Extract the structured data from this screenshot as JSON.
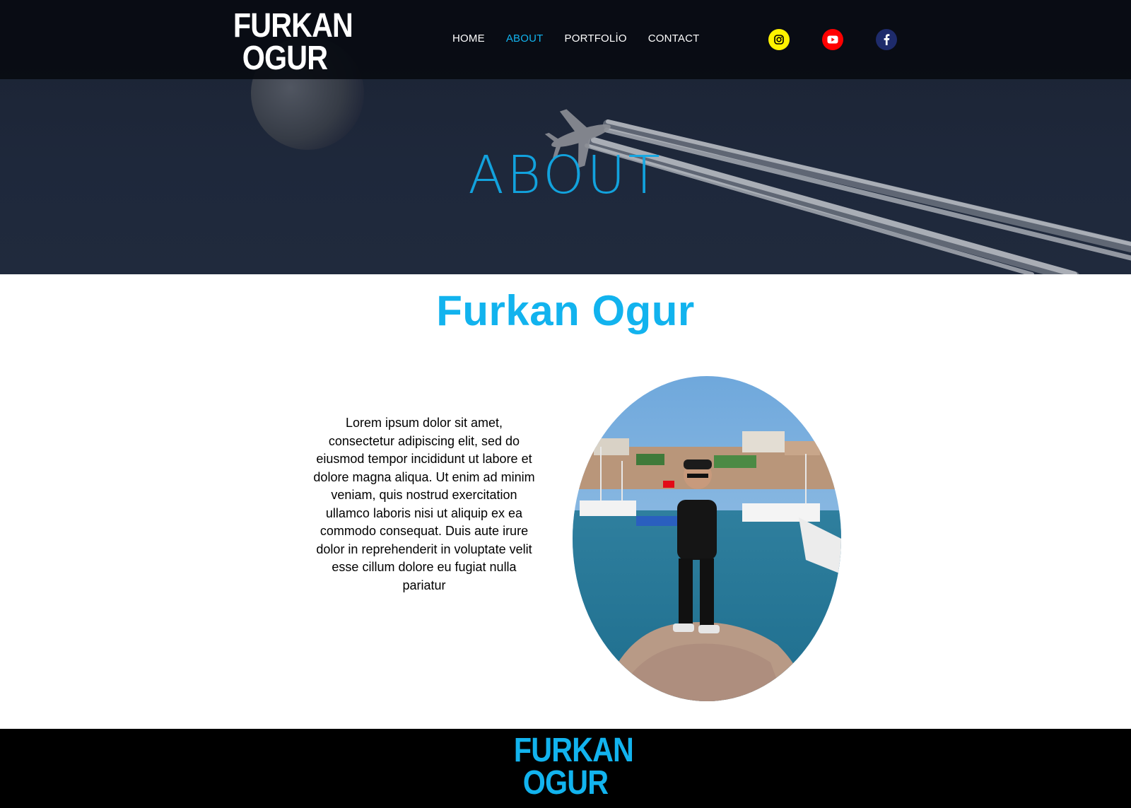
{
  "header": {
    "logo_line1": "FURKAN",
    "logo_line2": "OGUR"
  },
  "nav": {
    "items": [
      "HOME",
      "ABOUT",
      "PORTFOLİO",
      "CONTACT"
    ],
    "active": "ABOUT"
  },
  "social": [
    {
      "icon": "instagram-icon",
      "color": "#fff200"
    },
    {
      "icon": "youtube-icon",
      "color": "#ff0000"
    },
    {
      "icon": "facebook-icon",
      "color": "#1e2b6b"
    }
  ],
  "hero": {
    "title": "ABOUT"
  },
  "about": {
    "name": "Furkan Ogur",
    "text": "Lorem ipsum dolor sit amet, consectetur adipiscing elit, sed do eiusmod tempor incididunt ut labore et dolore magna aliqua. Ut enim ad minim veniam, quis nostrud exercitation ullamco laboris nisi ut aliquip ex ea commodo consequat. Duis aute irure dolor in reprehenderit in voluptate velit esse cillum dolore eu fugiat nulla pariatur"
  },
  "footer": {
    "logo_line1": "FURKAN",
    "logo_line2": "OGUR"
  },
  "colors": {
    "accent": "#12b3ee",
    "navbar": "#080b11",
    "footer": "#000000"
  }
}
